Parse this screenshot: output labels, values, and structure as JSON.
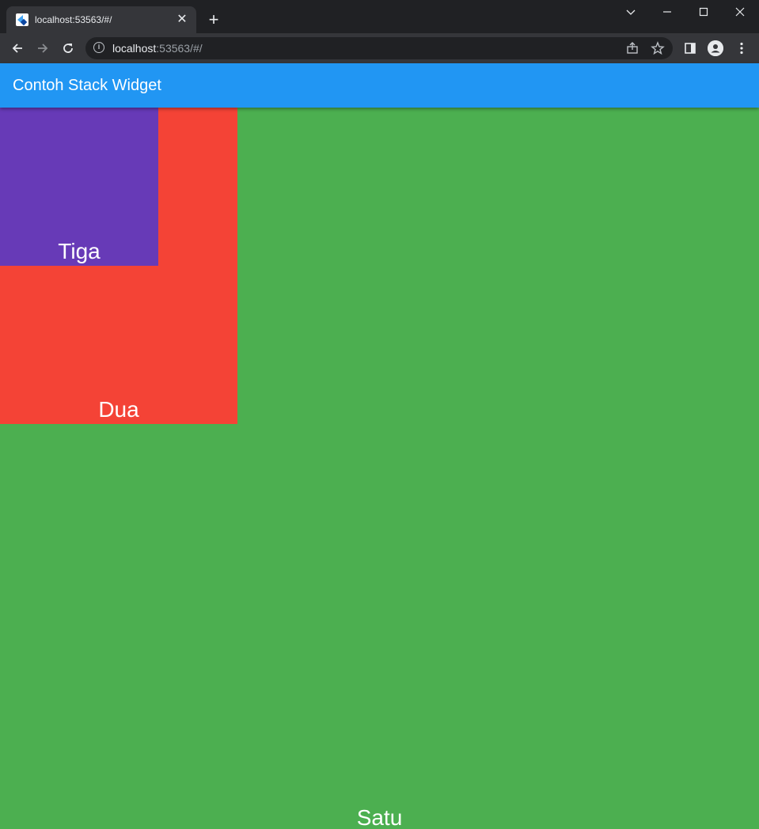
{
  "browser": {
    "tab_title": "localhost:53563/#/",
    "tab_close": "✕",
    "new_tab": "+",
    "url_host": "localhost",
    "url_rest": ":53563/#/"
  },
  "app": {
    "title": "Contoh Stack Widget",
    "appbar_color": "#2196f3",
    "boxes": [
      {
        "label": "Satu",
        "color": "#4caf50"
      },
      {
        "label": "Dua",
        "color": "#f44336"
      },
      {
        "label": "Tiga",
        "color": "#673ab7"
      }
    ]
  },
  "icons": [
    "flutter-favicon-icon",
    "back-icon",
    "forward-icon",
    "reload-icon",
    "info-icon",
    "share-icon",
    "star-icon",
    "side-panel-icon",
    "profile-icon",
    "menu-icon",
    "minimize-icon",
    "maximize-icon",
    "close-window-icon",
    "tab-search-icon"
  ]
}
